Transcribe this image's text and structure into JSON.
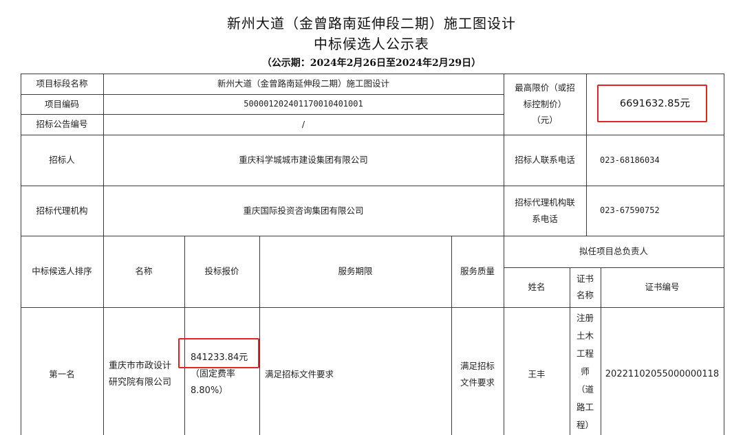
{
  "header": {
    "title_line1": "新州大道（金曾路南延伸段二期）施工图设计",
    "title_line2": "中标候选人公示表",
    "period": "（公示期：2024年2月26日至2024年2月29日）"
  },
  "project": {
    "name_label": "项目标段名称",
    "name_value": "新州大道（金曾路南延伸段二期）施工图设计",
    "code_label": "项目编码",
    "code_value": "500001202401170010401001",
    "notice_label": "招标公告编号",
    "notice_value": "/",
    "max_price_label_1": "最高限价（或招",
    "max_price_label_2": "标控制价）",
    "max_price_label_3": "（元）",
    "max_price_value": "6691632.85元"
  },
  "tenderer": {
    "label": "招标人",
    "value": "重庆科学城城市建设集团有限公司",
    "phone_label": "招标人联系电话",
    "phone_value": "023-68186034"
  },
  "agency": {
    "label": "招标代理机构",
    "value": "重庆国际投资咨询集团有限公司",
    "phone_label_1": "招标代理机构联",
    "phone_label_2": "系电话",
    "phone_value": "023-67590752"
  },
  "table_headers": {
    "rank": "中标候选人排序",
    "name": "名称",
    "bid": "投标报价",
    "period": "服务期限",
    "quality": "服务质量",
    "leader": "拟任项目总负责人",
    "person": "姓名",
    "cert_name_1": "证书",
    "cert_name_2": "名称",
    "cert_no": "证书编号"
  },
  "first_candidate": {
    "rank": "第一名",
    "name_line1": "重庆市市政设计",
    "name_line2": "研究院有限公司",
    "bid_amount": "841233.84元",
    "bid_note_1": "（固定费率",
    "bid_note_2": "8.80%）",
    "service_period": "满足招标文件要求",
    "quality_1": "满足招标",
    "quality_2": "文件要求",
    "person": "王丰",
    "cert_lines": [
      "注册",
      "土木",
      "工程",
      "师",
      "（道",
      "路工",
      "程）"
    ],
    "cert_no": "20221102055000000118"
  },
  "highlight_color": "#e02424"
}
